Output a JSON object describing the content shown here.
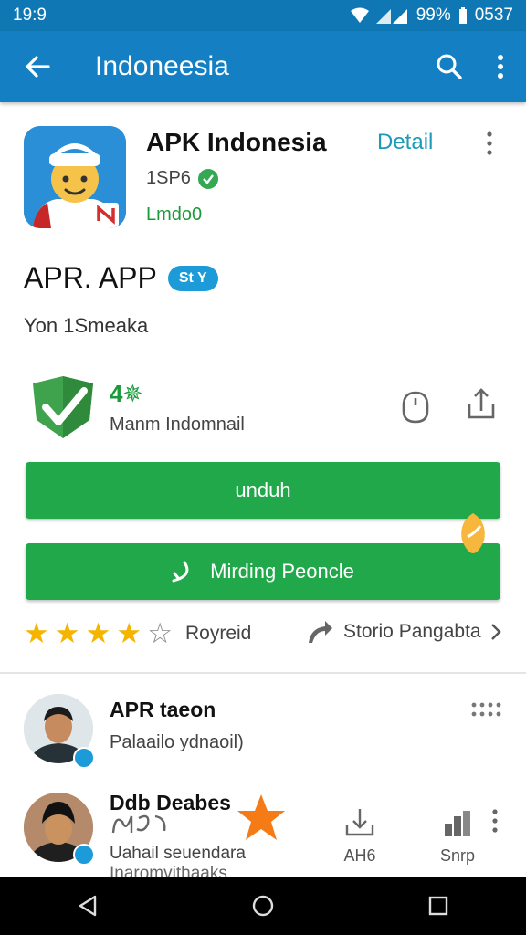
{
  "status_bar": {
    "time": "19:9",
    "battery_pct": "99%",
    "clock_right": "0537"
  },
  "app_bar": {
    "title": "Indoneesia"
  },
  "app": {
    "name": "APK Indonesia",
    "detail_link": "Detail",
    "size": "1SP6",
    "developer": "Lmdo0",
    "title2": "APR. APP",
    "badge": "St Y",
    "description": "Yon 1Smeaka",
    "rating_value": "4✵",
    "rating_label": "Manm Indomnail"
  },
  "buttons": {
    "download": "unduh",
    "secondary": "Mirding Peoncle"
  },
  "rating_row": {
    "stars_filled": 4,
    "stars_total": 5,
    "review_label": "Royreid",
    "store_label": "Storio Pangabta"
  },
  "reviews": [
    {
      "name": "APR taeon",
      "meta": "Palaailo ydnaoil)"
    },
    {
      "name": "Ddb Deabes",
      "meta": "Uahail seuendara",
      "meta2": "Inaromvithaaks"
    }
  ],
  "actions": [
    {
      "label": "AH6"
    },
    {
      "label": "Snrp"
    }
  ],
  "colors": {
    "primary": "#1480c3",
    "green": "#21a84a",
    "star": "#f4b400",
    "link": "#1c9bb8"
  }
}
